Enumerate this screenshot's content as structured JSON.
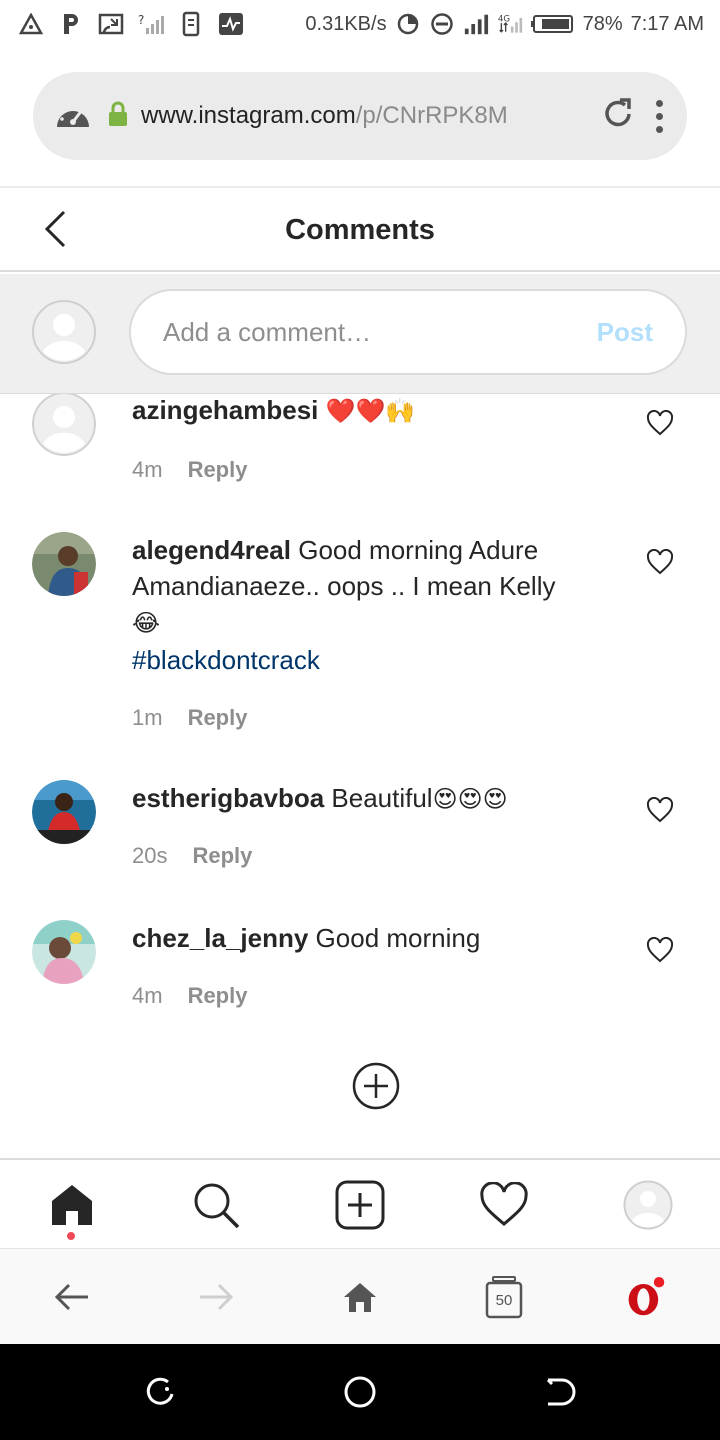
{
  "status_bar": {
    "network_speed": "0.31KB/s",
    "network_type": "4G",
    "battery": "78%",
    "time": "7:17 AM"
  },
  "browser": {
    "url_host": "www.instagram.com",
    "url_path": "/p/CNrRPK8M"
  },
  "header": {
    "title": "Comments"
  },
  "composer": {
    "placeholder": "Add a comment…",
    "post_label": "Post"
  },
  "comments": [
    {
      "username": "azingehambesi",
      "text": "",
      "emoji": "❤️❤️🙌",
      "hashtag": "",
      "time": "4m",
      "reply_label": "Reply"
    },
    {
      "username": "alegend4real",
      "text": "Good morning Adure Amandianaeze.. oops .. I mean Kelly",
      "emoji": "😂",
      "hashtag": "#blackdontcrack",
      "time": "1m",
      "reply_label": "Reply"
    },
    {
      "username": "estherigbavboa",
      "text": "Beautiful",
      "emoji": "😍😍😍",
      "hashtag": "",
      "time": "20s",
      "reply_label": "Reply"
    },
    {
      "username": "chez_la_jenny",
      "text": "Good morning",
      "emoji": "",
      "hashtag": "",
      "time": "4m",
      "reply_label": "Reply"
    }
  ],
  "browser_nav": {
    "tab_count": "50"
  },
  "colors": {
    "post_disabled": "#b2dffc",
    "hashtag": "#003569",
    "notification_dot": "#ed4956",
    "opera_red": "#cc0f16"
  },
  "icons": [
    "back-icon",
    "heart-icon",
    "add-circle-icon",
    "home-icon",
    "search-icon",
    "new-post-icon",
    "activity-icon",
    "profile-icon",
    "reload-icon",
    "lock-icon",
    "speedometer-icon",
    "opera-icon"
  ]
}
